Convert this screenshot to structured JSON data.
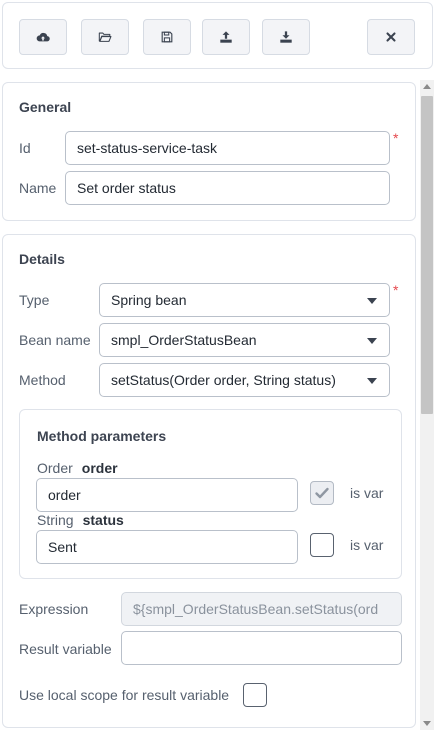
{
  "toolbar": {
    "buttons": [
      {
        "name": "upload-cloud",
        "icon": "cloud-upload-icon"
      },
      {
        "name": "open-folder",
        "icon": "folder-open-icon"
      },
      {
        "name": "save",
        "icon": "floppy-disk-icon"
      },
      {
        "name": "export",
        "icon": "upload-tray-icon"
      },
      {
        "name": "import",
        "icon": "download-tray-icon"
      },
      {
        "name": "close",
        "icon": "close-icon"
      }
    ]
  },
  "general": {
    "title": "General",
    "id_label": "Id",
    "id_value": "set-status-service-task",
    "name_label": "Name",
    "name_value": "Set order status",
    "required_mark": "*"
  },
  "details": {
    "title": "Details",
    "type_label": "Type",
    "type_value": "Spring bean",
    "bean_label": "Bean name",
    "bean_value": "smpl_OrderStatusBean",
    "method_label": "Method",
    "method_value": "setStatus(Order order, String status)",
    "required_mark": "*",
    "method_params": {
      "title": "Method parameters",
      "params": [
        {
          "type": "Order",
          "name": "order",
          "value": "order",
          "is_var": true,
          "is_var_label": "is var"
        },
        {
          "type": "String",
          "name": "status",
          "value": "Sent",
          "is_var": false,
          "is_var_label": "is var"
        }
      ]
    },
    "expression_label": "Expression",
    "expression_value": "${smpl_OrderStatusBean.setStatus(ord",
    "result_var_label": "Result variable",
    "result_var_value": "",
    "local_scope_label": "Use local scope for result variable",
    "local_scope_checked": false
  },
  "colors": {
    "required": "#e5484d",
    "border": "#dfe3ea",
    "input_border": "#b9c0ca"
  }
}
